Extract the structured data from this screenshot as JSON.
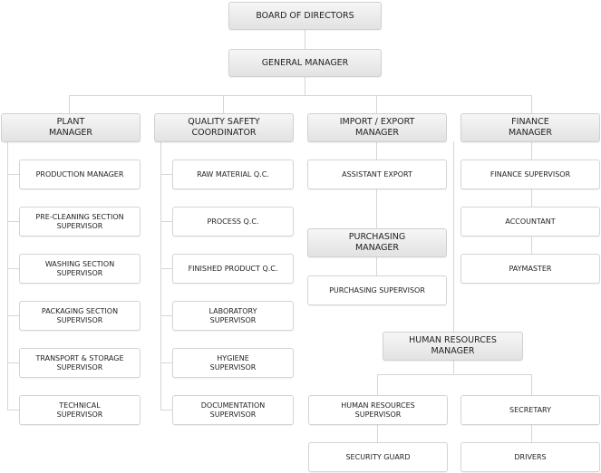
{
  "board": "BOARD OF DIRECTORS",
  "gm": "GENERAL MANAGER",
  "plant": {
    "title": "PLANT\nMANAGER",
    "items": [
      "PRODUCTION MANAGER",
      "PRE-CLEANING SECTION\nSUPERVISOR",
      "WASHING SECTION\nSUPERVISOR",
      "PACKAGING SECTION\nSUPERVISOR",
      "TRANSPORT & STORAGE\nSUPERVISOR",
      "TECHNICAL\nSUPERVISOR"
    ]
  },
  "quality": {
    "title": "QUALITY SAFETY\nCOORDINATOR",
    "items": [
      "RAW MATERIAL Q.C.",
      "PROCESS Q.C.",
      "FINISHED PRODUCT Q.C.",
      "LABORATORY\nSUPERVISOR",
      "HYGIENE\nSUPERVISOR",
      "DOCUMENTATION\nSUPERVISOR"
    ]
  },
  "import": {
    "title": "IMPORT / EXPORT\nMANAGER",
    "assistant": "ASSISTANT EXPORT",
    "purchasing_manager": "PURCHASING\nMANAGER",
    "purchasing_supervisor": "PURCHASING SUPERVISOR"
  },
  "finance": {
    "title": "FINANCE\nMANAGER",
    "items": [
      "FINANCE SUPERVISOR",
      "ACCOUNTANT",
      "PAYMASTER"
    ]
  },
  "hr": {
    "title": "HUMAN RESOURCES\nMANAGER",
    "supervisor": "HUMAN RESOURCES\nSUPERVISOR",
    "secretary": "SECRETARY",
    "security": "SECURITY GUARD",
    "drivers": "DRIVERS"
  }
}
